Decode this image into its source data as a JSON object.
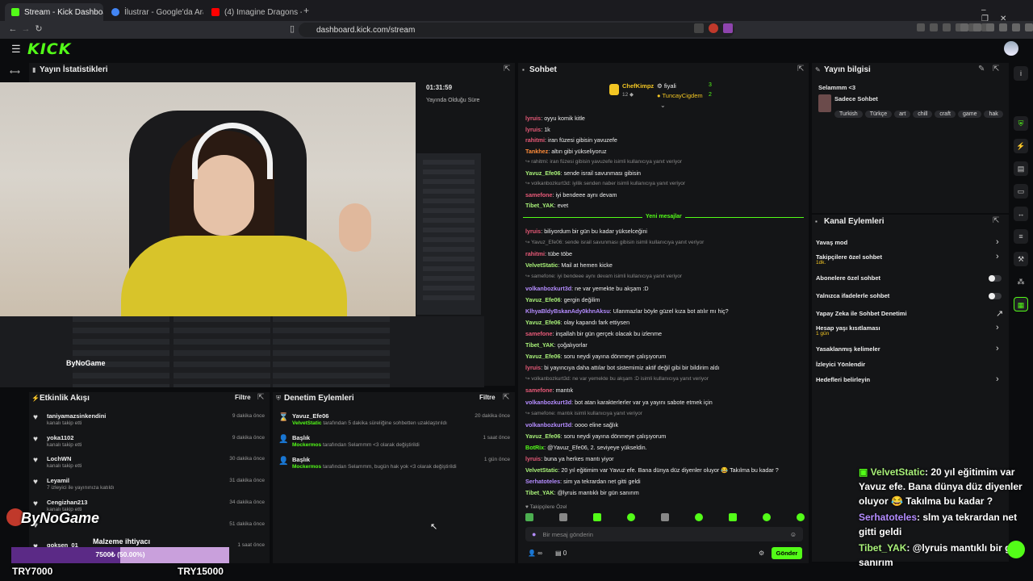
{
  "browser": {
    "tabs": [
      {
        "title": "Stream - Kick Dashboard",
        "close": "×",
        "color": "#53fc18"
      },
      {
        "title": "İlustrar - Google'da Ara",
        "close": "×",
        "color": "#4285f4"
      },
      {
        "title": "(4) Imagine Dragons - Radioacti...",
        "close": "×",
        "color": "#ff0000"
      }
    ],
    "newtab": "+",
    "url": "dashboard.kick.com/stream",
    "window_controls": [
      "–",
      "❐",
      "✕"
    ]
  },
  "header": {
    "logo": "KICK",
    "menu_icon": "☰"
  },
  "stats": {
    "title": "Yayın İstatistikleri",
    "elapsed": "01:31:59",
    "elapsed_label": "Yayında Olduğu Süre"
  },
  "chat": {
    "title": "Sohbet",
    "leaders": [
      {
        "name": "ChefKimpz",
        "sub": "12 ◆"
      },
      {
        "name": "fiyali",
        "count": "3"
      },
      {
        "name": "TuncayCigdem",
        "count": "2"
      }
    ],
    "messages": [
      {
        "user": "lyruis",
        "color": "#e85a78",
        "text": "oyyu komik kitle"
      },
      {
        "user": "lyruis",
        "color": "#e85a78",
        "text": "1k"
      },
      {
        "user": "rahitmi",
        "color": "#e85a78",
        "text": "iran füzesi gibisin yavuzefe"
      },
      {
        "user": "Tankhez",
        "color": "#ff8c3a",
        "text": "altın gibi yükseliyoruz"
      },
      {
        "reply": "rahitmi: iran füzesi gibisin yavuzefe isimli kullanıcıya yanıt veriyor"
      },
      {
        "user": "Yavuz_Efe06",
        "color": "#a8f078",
        "text": "sende israil savunması gibisin"
      },
      {
        "reply": "volkanbozkurt3d: iyilik senden naber isimli kullanıcıya yanıt veriyor"
      },
      {
        "user": "samefone",
        "color": "#e85a78",
        "text": "iyi bendeee aynı devam"
      },
      {
        "user": "Tibet_YAK",
        "color": "#a8f078",
        "text": "evet"
      }
    ],
    "new_messages_label": "Yeni mesajlar",
    "messages2": [
      {
        "user": "lyruis",
        "color": "#e85a78",
        "text": "biliyordum bir gün bu kadar yükselceğini"
      },
      {
        "reply": "Yavuz_Efe06: sende israil savunması gibisin isimli kullanıcıya yanıt veriyor"
      },
      {
        "user": "rahitmi",
        "color": "#e85a78",
        "text": "tübe töbe"
      },
      {
        "user": "VelvetStatic",
        "color": "#a8f078",
        "text": "Mail at hemen kicke"
      },
      {
        "reply": "samefone: iyi bendeee aynı devam isimli kullanıcıya yanıt veriyor"
      },
      {
        "user": "volkanbozkurt3d",
        "color": "#b48cff",
        "text": "ne var yemekte bu akşam :D"
      },
      {
        "user": "Yavuz_Efe06",
        "color": "#a8f078",
        "text": "gergin değilim"
      },
      {
        "user": "KlhyaBldyBskanAdy0khnAksu",
        "color": "#b48cff",
        "text": "Ulanmazlar böyle güzel kıza bot atılır mı hiç?"
      },
      {
        "user": "Yavuz_Efe06",
        "color": "#a8f078",
        "text": "olay kapandı fark ettiysen"
      },
      {
        "user": "samefone",
        "color": "#e85a78",
        "text": "inşallah bir gün gerçek olacak bu izlenme"
      },
      {
        "user": "Tibet_YAK",
        "color": "#a8f078",
        "text": "çoğalıyorlar"
      },
      {
        "user": "Yavuz_Efe06",
        "color": "#a8f078",
        "text": "soru neydi yayına dönmeye çalışıyorum"
      },
      {
        "user": "lyruis",
        "color": "#e85a78",
        "text": "bi yayıncıya daha attılar bot sistemimiz aktif değil gibi bir bildirim aldı"
      },
      {
        "reply": "volkanbozkurt3d: ne var yemekte bu akşam :D isimli kullanıcıya yanıt veriyor"
      },
      {
        "user": "samefone",
        "color": "#e85a78",
        "text": "mantık"
      },
      {
        "user": "volkanbozkurt3d",
        "color": "#b48cff",
        "text": "bot atan karakterlerler var ya yayını sabote etmek için"
      },
      {
        "reply": "samefone: mantık isimli kullanıcıya yanıt veriyor"
      },
      {
        "user": "volkanbozkurt3d",
        "color": "#b48cff",
        "text": "oooo eline sağlık"
      },
      {
        "user": "Yavuz_Efe06",
        "color": "#a8f078",
        "text": "soru neydi yayına dönmeye çalışıyorum"
      },
      {
        "user": "BotRix",
        "color": "#53fc18",
        "text": "@Yavuz_Efe06, 2. seviyeye yükseldin."
      },
      {
        "user": "lyruis",
        "color": "#e85a78",
        "text": "buna ya herkes mantı yiyor"
      },
      {
        "user": "VelvetStatic",
        "color": "#a8f078",
        "text": "20 yıl eğitimim var Yavuz efe. Bana dünya düz diyenler oluyor 😂 Takılma bu kadar ?"
      },
      {
        "user": "Serhatoteles",
        "color": "#b48cff",
        "text": "sim ya tekrardan net gitti geldi"
      },
      {
        "user": "Tibet_YAK",
        "color": "#a8f078",
        "text": "@lyruis mantıklı bir gün sanırım"
      }
    ],
    "followers_only": "Takipçilere Özel",
    "input_placeholder": "Bir mesaj gönderin",
    "send": "Gönder",
    "viewer_count": "∞",
    "zero": "0"
  },
  "info": {
    "title": "Yayın bilgisi",
    "stream_title": "Selammm <3",
    "category": "Sadece Sohbet",
    "tags": [
      "Turkish",
      "Türkçe",
      "art",
      "chill",
      "craft",
      "game",
      "hak"
    ]
  },
  "actions": {
    "title": "Kanal Eylemleri",
    "items": [
      {
        "label": "Yavaş mod",
        "control": "›"
      },
      {
        "label": "Takipçilere özel sohbet",
        "sub": "1dk.",
        "control": "›"
      },
      {
        "label": "Abonelere özel sohbet",
        "control": "toggle"
      },
      {
        "label": "Yalnızca ifadelerle sohbet",
        "control": "toggle"
      },
      {
        "label": "Yapay Zeka ile Sohbet Denetimi",
        "control": "↗"
      },
      {
        "label": "Hesap yaşı kısıtlaması",
        "sub": "1 gün",
        "control": "›"
      },
      {
        "label": "Yasaklanmış kelimeler",
        "control": "›"
      },
      {
        "label": "İzleyici Yönlendir",
        "control": ""
      },
      {
        "label": "Hedefleri belirleyin",
        "control": "›"
      }
    ]
  },
  "activity": {
    "title": "Etkinlik Akışı",
    "filter": "Filtre",
    "events": [
      {
        "name": "taniyamazsinkendini",
        "desc": "kanalı takip etti",
        "time": "9 dakika önce"
      },
      {
        "name": "yoka1102",
        "desc": "kanalı takip etti",
        "time": "9 dakika önce"
      },
      {
        "name": "LochWN",
        "desc": "kanalı takip etti",
        "time": "30 dakika önce"
      },
      {
        "name": "Leyamil",
        "desc": "7 izleyici ile yayınınıza katıldı",
        "time": "31 dakika önce"
      },
      {
        "name": "Cengizhan213",
        "desc": "kanalı takip etti",
        "time": "34 dakika önce"
      },
      {
        "name": "",
        "desc": "",
        "time": "51 dakika önce"
      },
      {
        "name": "goksen_01",
        "desc": "",
        "time": "1 saat önce"
      }
    ]
  },
  "moderation": {
    "title": "Denetim Eylemleri",
    "filter": "Filtre",
    "events": [
      {
        "name": "Yavuz_Efe06",
        "by": "VelvetStatic",
        "desc": "tarafından 5 dakika süreliğine sohbetten uzaklaştırıldı",
        "time": "20 dakika önce"
      },
      {
        "name": "Başlık",
        "by": "Mockermos",
        "desc": "tarafından Selammm <3 olarak değiştirildi",
        "time": "1 saat önce"
      },
      {
        "name": "Başlık",
        "by": "Mockermos",
        "desc": "tarafından Selammm, bugün hak yok <3 olarak değiştirildi",
        "time": "1 gün önce"
      }
    ]
  },
  "overlay": {
    "brand": "ByNoGame",
    "goal_label": "Malzeme ihtiyacı",
    "goal_text": "7500₺ (50.00%)",
    "goal_progress": 0.5,
    "goal_left": "TRY7000",
    "goal_right": "TRY15000",
    "chat": [
      {
        "user": "VelvetStatic",
        "color": "#a8f078",
        "text": ": 20 yıl eğitimim var Yavuz efe. Bana dünya düz diyenler oluyor 😂 Takılma bu kadar ?"
      },
      {
        "user": "Serhatoteles",
        "color": "#b48cff",
        "text": ": slm ya tekrardan net gitti geldi"
      },
      {
        "user": "Tibet_YAK",
        "color": "#a8f078",
        "text": ": @lyruis mantıklı bir gün sanırım"
      }
    ]
  }
}
